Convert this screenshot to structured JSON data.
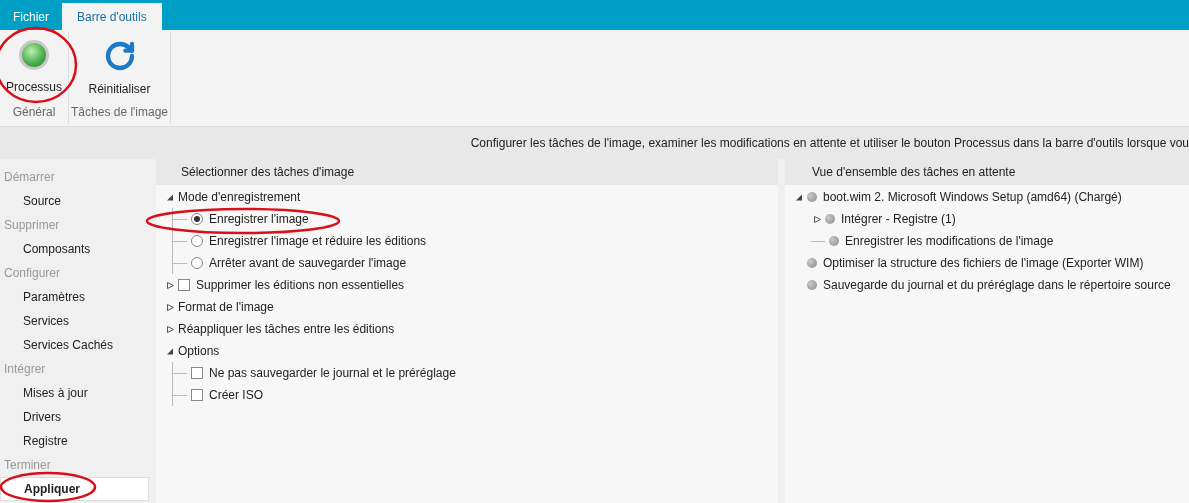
{
  "menu_tabs": [
    {
      "label": "Fichier",
      "selected": false
    },
    {
      "label": "Barre d'outils",
      "selected": true
    }
  ],
  "ribbon": {
    "groups": [
      {
        "label": "Général",
        "buttons": [
          {
            "label": "Processus",
            "kind": "process"
          }
        ]
      },
      {
        "label": "Tâches de l'image",
        "buttons": [
          {
            "label": "Réinitialiser",
            "kind": "reset"
          }
        ]
      }
    ]
  },
  "info_bar": "Configurer les tâches de l'image, examiner les modifications en attente et utiliser le bouton Processus dans la barre d'outils lorsque vou",
  "sidebar": [
    {
      "header": "Démarrer",
      "items": [
        {
          "label": "Source",
          "selected": false
        }
      ]
    },
    {
      "header": "Supprimer",
      "items": [
        {
          "label": "Composants",
          "selected": false
        }
      ]
    },
    {
      "header": "Configurer",
      "items": [
        {
          "label": "Paramètres",
          "selected": false
        },
        {
          "label": "Services",
          "selected": false
        },
        {
          "label": "Services Cachés",
          "selected": false
        }
      ]
    },
    {
      "header": "Intégrer",
      "items": [
        {
          "label": "Mises à jour",
          "selected": false
        },
        {
          "label": "Drivers",
          "selected": false
        },
        {
          "label": "Registre",
          "selected": false
        }
      ]
    },
    {
      "header": "Terminer",
      "items": [
        {
          "label": "Appliquer",
          "selected": true
        }
      ]
    }
  ],
  "tasks_panel": {
    "title": "Sélectionner des tâches d'image",
    "items": [
      {
        "kind": "group",
        "label": "Mode d'enregistrement",
        "expanded": true,
        "children": [
          {
            "kind": "radio",
            "label": "Enregistrer l'image",
            "selected": true
          },
          {
            "kind": "radio",
            "label": "Enregistrer l'image et réduire les éditions",
            "selected": false
          },
          {
            "kind": "radio",
            "label": "Arrêter avant de sauvegarder l'image",
            "selected": false
          }
        ]
      },
      {
        "kind": "checkbox",
        "label": "Supprimer les éditions non essentielles",
        "expanded": false,
        "checked": false
      },
      {
        "kind": "group",
        "label": "Format de l'image",
        "expanded": false
      },
      {
        "kind": "group",
        "label": "Réappliquer les tâches entre les éditions",
        "expanded": false
      },
      {
        "kind": "group",
        "label": "Options",
        "expanded": true,
        "children": [
          {
            "kind": "checkbox",
            "label": "Ne pas sauvegarder le journal et le préréglage",
            "checked": false
          },
          {
            "kind": "checkbox",
            "label": "Créer ISO",
            "checked": false
          }
        ]
      }
    ]
  },
  "pending_panel": {
    "title": "Vue d'ensemble des tâches en attente",
    "items": [
      {
        "label": "boot.wim 2. Microsoft Windows Setup (amd64)  (Chargé)",
        "expanded": true,
        "children": [
          {
            "label": "Intégrer - Registre (1)",
            "expanded": false
          },
          {
            "label": "Enregistrer les modifications de l'image"
          }
        ]
      },
      {
        "label": "Optimiser la structure des fichiers de l'image (Exporter WIM)"
      },
      {
        "label": "Sauvegarde du journal et du préréglage dans le répertoire source"
      }
    ]
  }
}
